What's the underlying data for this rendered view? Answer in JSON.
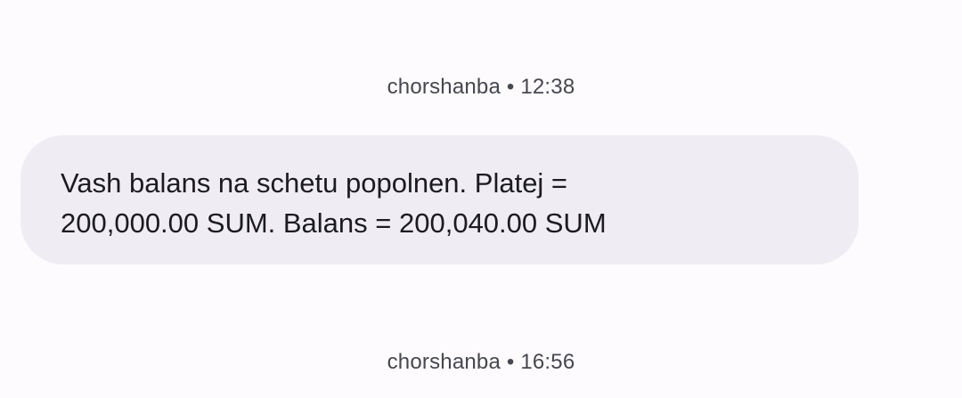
{
  "conversation": {
    "messages": [
      {
        "timestamp": "chorshanba • 12:38",
        "text": "Vash balans na schetu popolnen. Platej =\n200,000.00 SUM. Balans = 200,040.00 SUM"
      },
      {
        "timestamp": "chorshanba • 16:56"
      }
    ]
  },
  "colors": {
    "background": "#fdfbfe",
    "bubble": "#efedf3",
    "timestamp_text": "#46474f",
    "message_text": "#1b1b21"
  }
}
